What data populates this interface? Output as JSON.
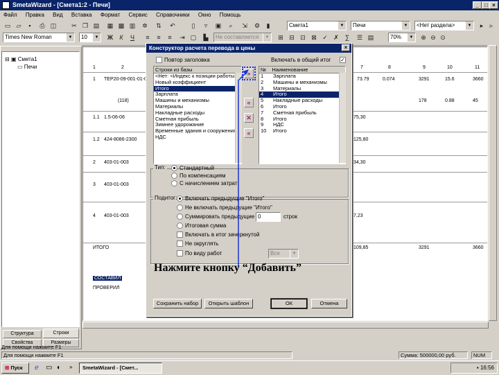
{
  "window": {
    "title": "SmetaWizard - [Смета1:2 - Печи]"
  },
  "menu": [
    "Файл",
    "Правка",
    "Вид",
    "Вставка",
    "Формат",
    "Сервис",
    "Справочники",
    "Окно",
    "Помощь"
  ],
  "toolbar1": {
    "estimate_combo": "Смета1",
    "section_combo": "Печи",
    "subsection_combo": "<Нет раздела>"
  },
  "toolbar2": {
    "font_combo": "Times New Roman",
    "size_combo": "10",
    "style_combo": "Не составляется",
    "zoom_combo": "70%"
  },
  "tree": {
    "root": "Смета1",
    "child": "Печи"
  },
  "left_tabs": [
    "Структура",
    "Строки",
    "Свойства",
    "Размеры"
  ],
  "doc": {
    "header_nums": [
      "1",
      "2",
      "3",
      "7",
      "8",
      "9",
      "10",
      "11"
    ],
    "rows": [
      {
        "n": "1",
        "code": "ТЕР20-09-001-01-0-1.5-4",
        "v1": "73.79",
        "v2": "0.074",
        "v3": "3291",
        "v4": "15.6",
        "v5": "3660"
      },
      {
        "n": "",
        "code": "(118)",
        "v1": "",
        "v2": "",
        "v3": "178",
        "v4": "0.88",
        "v5": "45"
      },
      {
        "n": "1.1",
        "code": "1.5-06-06",
        "v1": "75,30",
        "v2": "",
        "v3": "",
        "v4": "",
        "v5": ""
      },
      {
        "n": "1.2",
        "code": "424-8086-2300",
        "v1": "125,80",
        "v2": "",
        "v3": "",
        "v4": "",
        "v5": ""
      },
      {
        "n": "2",
        "code": "403-01-003",
        "v1": "34,30",
        "v2": "",
        "v3": "",
        "v4": "",
        "v5": ""
      },
      {
        "n": "3",
        "code": "403-01-003",
        "v1": "",
        "v2": "",
        "v3": "",
        "v4": "",
        "v5": ""
      },
      {
        "n": "4",
        "code": "403-01-003",
        "v1": "7,23",
        "v2": "",
        "v3": "",
        "v4": "",
        "v5": ""
      }
    ],
    "total_label": "ИТОГО",
    "total": {
      "v1": "109,85",
      "v2": "",
      "v3": "3291",
      "v4": "",
      "v5": "3660"
    },
    "sub_total": {
      "v3": "",
      "v4": "",
      "v5": ""
    },
    "compiled_label": "СОСТАВИЛ",
    "checked_label": "ПРОВЕРИЛ"
  },
  "dialog": {
    "title": "Конструктор расчета перевода в цены",
    "cb_repeat": "Повтор заголовка",
    "cb_include": "Включать в общий итог",
    "base_list_title": "Строки из базы",
    "base_items": [
      "<Нет: <Индекс к позиции работы>",
      "Новый коэффициент",
      "Итого",
      "Зарплата",
      "Машины и механизмы",
      "Материалы",
      "Накладные расходы",
      "Сметная прибыль",
      "Зимнее удорожание",
      "Временные здания и сооружения",
      "НДС"
    ],
    "base_selected_index": 2,
    "col_num": "№",
    "col_name": "Наименование",
    "result_items": [
      {
        "n": "1",
        "name": "Зарплата"
      },
      {
        "n": "2",
        "name": "Машины и механизмы"
      },
      {
        "n": "3",
        "name": "Материалы"
      },
      {
        "n": "4",
        "name": "Итого"
      },
      {
        "n": "5",
        "name": "Накладные расходы"
      },
      {
        "n": "6",
        "name": "Итого"
      },
      {
        "n": "7",
        "name": "Сметная прибыль"
      },
      {
        "n": "8",
        "name": "Итого"
      },
      {
        "n": "9",
        "name": "НДС"
      },
      {
        "n": "10",
        "name": "Итого"
      }
    ],
    "result_selected_index": 3,
    "type_label": "Тип:",
    "type_options": [
      "Стандартный",
      "По компенсациям",
      "С начислением затрат"
    ],
    "total_label": "Подитог:",
    "total_options": [
      "Включать предыдущие \"Итого\"",
      "Не включать предыдущие \"Итого\"",
      "Суммировать предыдущие",
      "Итоговая сумма"
    ],
    "sum_value": "0",
    "sum_suffix": "строк",
    "cb_include_sum": "Включать в итог зачеркнутой",
    "cb_round": "Не округлять",
    "cb_cost": "По виду работ",
    "cost_combo": "Все",
    "btn_save": "Сохранить набор",
    "btn_open": "Открыть шаблон",
    "btn_ok": "ОК",
    "btn_cancel": "Отмена"
  },
  "callout": "Нажмите кнопку “Добавить”",
  "status": {
    "help": "Для помощи нажмите F1",
    "sum": "Сумма: 500000,00 руб.",
    "num": "NUM"
  },
  "page_status": "Для помощи нажмите F1",
  "taskbar": {
    "start": "Пуск",
    "task": "SmetaWizard - [Смет...",
    "clock": "16:56"
  }
}
